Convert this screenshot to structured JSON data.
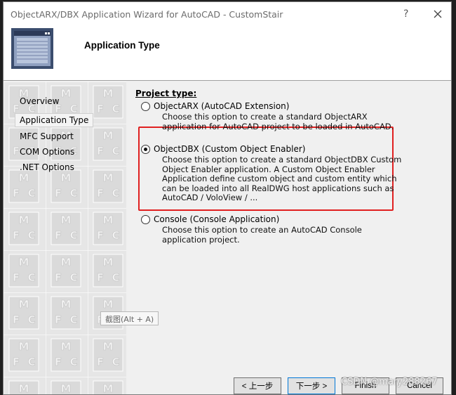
{
  "window": {
    "title": "ObjectARX/DBX Application Wizard for AutoCAD - CustomStair",
    "help_glyph": "?",
    "close_icon": "close-icon"
  },
  "header": {
    "title": "Application Type",
    "icon": "wizard-window-icon"
  },
  "sidebar": {
    "watermark_letters": [
      "M",
      "F",
      "C"
    ],
    "items": [
      {
        "label": "Overview",
        "selected": false
      },
      {
        "label": "Application Type",
        "selected": true
      },
      {
        "label": "MFC Support",
        "selected": false
      },
      {
        "label": "COM Options",
        "selected": false
      },
      {
        "label": ".NET Options",
        "selected": false
      }
    ]
  },
  "main": {
    "section_title": "Project type:",
    "options": [
      {
        "label": "ObjectARX (AutoCAD Extension)",
        "checked": false,
        "description": "Choose this option to create a standard ObjectARX application for AutoCAD project to be loaded in AutoCAD."
      },
      {
        "label": "ObjectDBX (Custom Object Enabler)",
        "checked": true,
        "description": "Choose this option to create a standard ObjectDBX Custom Object Enabler application. A Custom Object Enabler Application define custom object and custom entity which can be loaded into all RealDWG host applications such as AutoCAD / VoloView / ..."
      },
      {
        "label": "Console (Console Application)",
        "checked": false,
        "description": "Choose this option to create an AutoCAD Console application project."
      }
    ],
    "highlight_color": "#e02020"
  },
  "tooltip": {
    "text": "截图(Alt + A)"
  },
  "footer": {
    "back_label": "< 上一步",
    "next_label": "下一步 >",
    "finish_label": "Finish",
    "cancel_label": "Cancel",
    "watermark": "CSDN @mary288267"
  }
}
